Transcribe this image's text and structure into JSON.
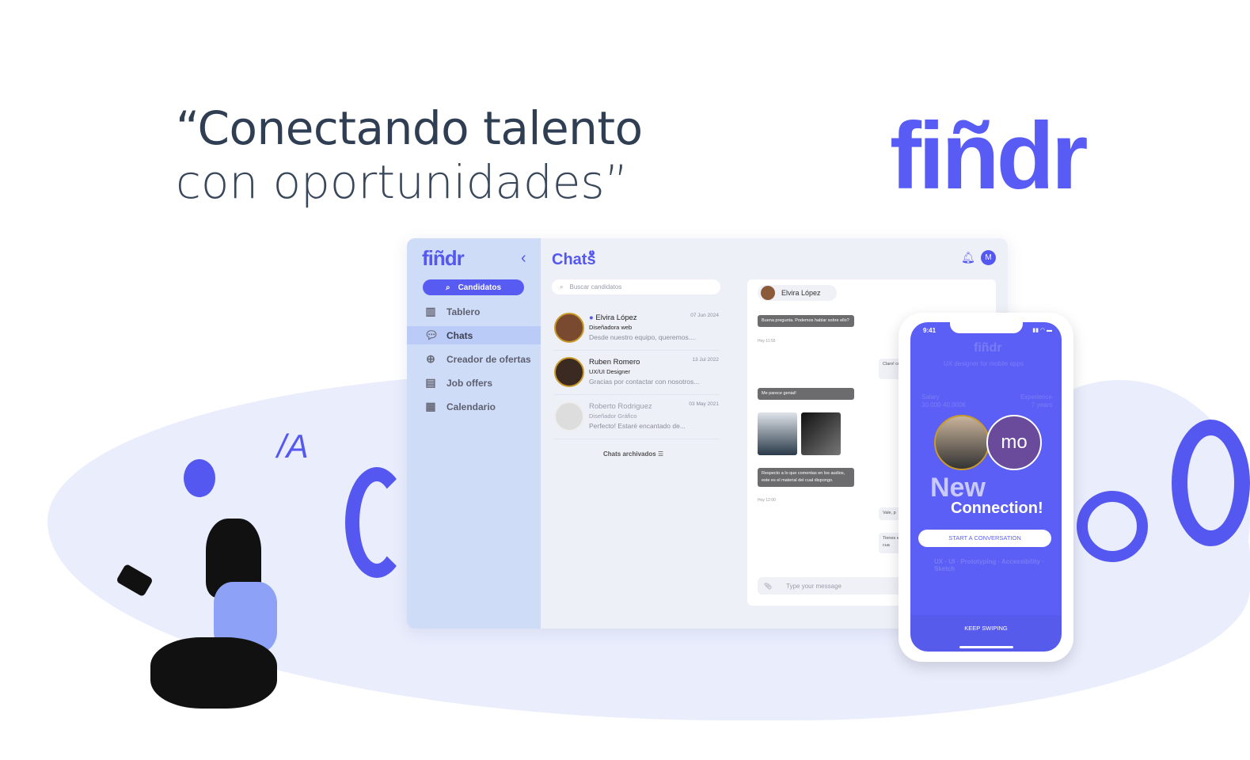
{
  "hero": {
    "line1": "“Conectando talento",
    "line2": "con oportunidades”",
    "logo": "fiñdr"
  },
  "colors": {
    "brand": "#585cf4",
    "sidebar": "#cfdcf8",
    "headline": "#2f3e52"
  },
  "dashboard": {
    "sidebar": {
      "logo": "fiñdr",
      "collapse_icon": "chevron-left-icon",
      "search_button": "Candidatos",
      "items": [
        {
          "label": "Tablero",
          "icon": "board-icon"
        },
        {
          "label": "Chats",
          "icon": "chat-icon",
          "active": true
        },
        {
          "label": "Creador de ofertas",
          "icon": "plus-circle-icon"
        },
        {
          "label": "Job offers",
          "icon": "job-icon"
        },
        {
          "label": "Calendario",
          "icon": "calendar-icon"
        }
      ]
    },
    "header": {
      "title": "Chats",
      "badge": "1",
      "avatar": "M"
    },
    "search": {
      "placeholder": "Buscar candidatos"
    },
    "chats": [
      {
        "name": "Elvira  López",
        "role": "Diseñadora web",
        "preview": "Desde nuestro equipo, queremos....",
        "date": "07 Jun 2024",
        "online": true
      },
      {
        "name": "Ruben Romero",
        "role": "UX/UI Designer",
        "preview": "Gracias por contactar con nosotros...",
        "date": "13 Jul 2022"
      },
      {
        "name": "Roberto Rodriguez",
        "role": "Diseñador Gráfico",
        "preview": "Perfecto! Estaré encantado de...",
        "date": "03 May 2021"
      }
    ],
    "archived": "Chats archivados",
    "conversation": {
      "contact": "Elvira  López",
      "messages": [
        {
          "text": "Buena pregunta. Podemos hablar sobre ello?",
          "time": "Hoy 11:55"
        },
        {
          "text": "Claro! cuenta"
        },
        {
          "text": "Me parece genial!"
        },
        {
          "text": "Respecto a lo que comentas en los audios, este es el material del cual dispongo.",
          "time": "Hoy 12:00"
        },
        {
          "text": "Vale, p"
        },
        {
          "text": "Tienes en cua"
        }
      ],
      "input_placeholder": "Type your message"
    }
  },
  "phone": {
    "time": "9:41",
    "bg_logo": "fiñdr",
    "bg_job": "UX designer for mobile apps",
    "bg_salary_label": "Salary",
    "bg_salary": "30.000-40.000€",
    "bg_exp_label": "Experience",
    "bg_exp": "7 years",
    "company_logo": "mo",
    "title1": "New",
    "title2": "Connection!",
    "start_button": "START A CONVERSATION",
    "skills": "UX · UI · Prototyping · Accessibility · Sketch",
    "keep_swiping": "KEEP SWIPING"
  }
}
